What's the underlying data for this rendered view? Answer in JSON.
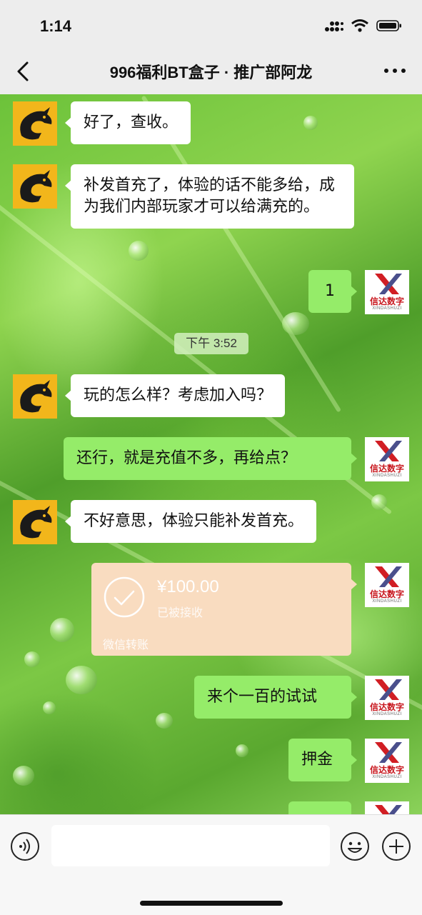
{
  "status_bar": {
    "time": "1:14"
  },
  "nav": {
    "title": "996福利BT盒子 · 推广部阿龙"
  },
  "avatar_brand": {
    "name": "信达数字",
    "sub": "XINDASHUZI"
  },
  "messages": [
    {
      "side": "in",
      "text": "好了，查收。"
    },
    {
      "side": "in",
      "text": "补发首充了，体验的话不能多给，成为我们内部玩家才可以给满充的。"
    },
    {
      "side": "out",
      "text": "1"
    },
    {
      "side": "in",
      "text": "玩的怎么样？考虑加入吗？"
    },
    {
      "side": "out",
      "text": "还行，就是充值不多，再给点？"
    },
    {
      "side": "in",
      "text": "不好意思，体验只能补发首充。"
    },
    {
      "side": "out",
      "text": "来个一百的试试"
    },
    {
      "side": "out",
      "text": "押金"
    }
  ],
  "timestamp": "下午 3:52",
  "transfer": {
    "amount": "¥100.00",
    "status": "已被接收",
    "label": "微信转账"
  },
  "colors": {
    "bubble_out": "#95ec69",
    "bubble_in": "#ffffff",
    "transfer": "#f9dcc0",
    "avatar_bg": "#f2b61b"
  }
}
